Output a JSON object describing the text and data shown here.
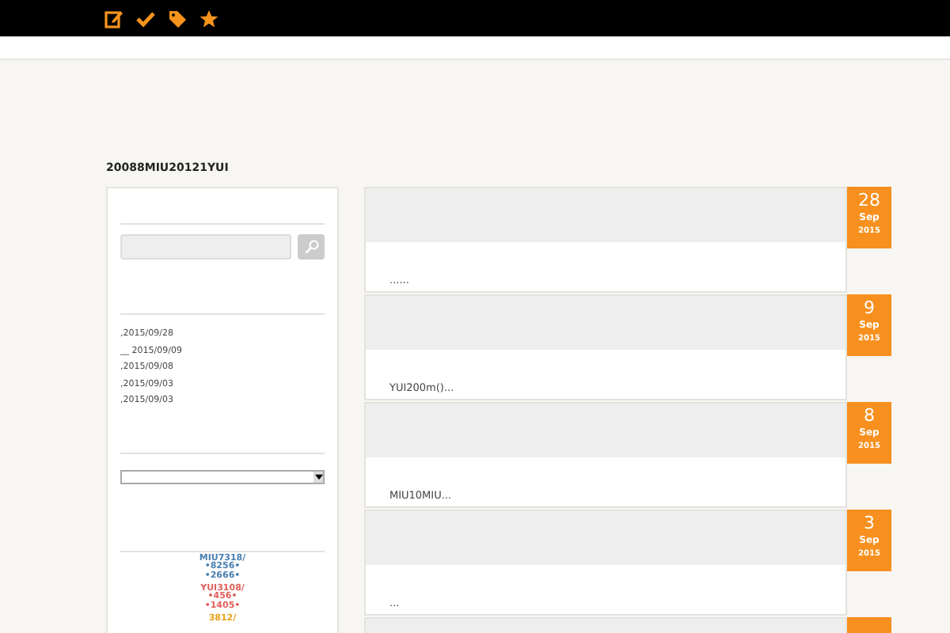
{
  "toolbar": {
    "icons": [
      {
        "kind": "edit"
      },
      {
        "kind": "check"
      },
      {
        "kind": "tag"
      },
      {
        "kind": "star"
      }
    ]
  },
  "blog_title": "20088MIU20121YUI",
  "sidebar": {
    "recent_posts": [
      ",2015/09/28",
      "__ 2015/09/09",
      ",2015/09/08",
      ",2015/09/03",
      ",2015/09/03"
    ],
    "stats": [
      {
        "lines": [
          "MIU7318/",
          "•8256•",
          "•2666•"
        ],
        "color": "#4a7fb0"
      },
      {
        "lines": [
          "YUI3108/",
          "•456•",
          "•1405•"
        ],
        "color": "#e0605a"
      },
      {
        "lines": [
          "3812/"
        ],
        "color": "#e8a317"
      }
    ]
  },
  "posts": [
    {
      "kind": "full",
      "excerpt": "......",
      "day": "28",
      "month": "Sep",
      "year": "2015"
    },
    {
      "kind": "full",
      "excerpt": "YUI200m()...",
      "day": "9",
      "month": "Sep",
      "year": "2015"
    },
    {
      "kind": "full",
      "excerpt": "MIU10MIU...",
      "day": "8",
      "month": "Sep",
      "year": "2015"
    },
    {
      "kind": "full",
      "excerpt": "...",
      "day": "3",
      "month": "Sep",
      "year": "2015"
    },
    {
      "kind": "cut"
    }
  ]
}
